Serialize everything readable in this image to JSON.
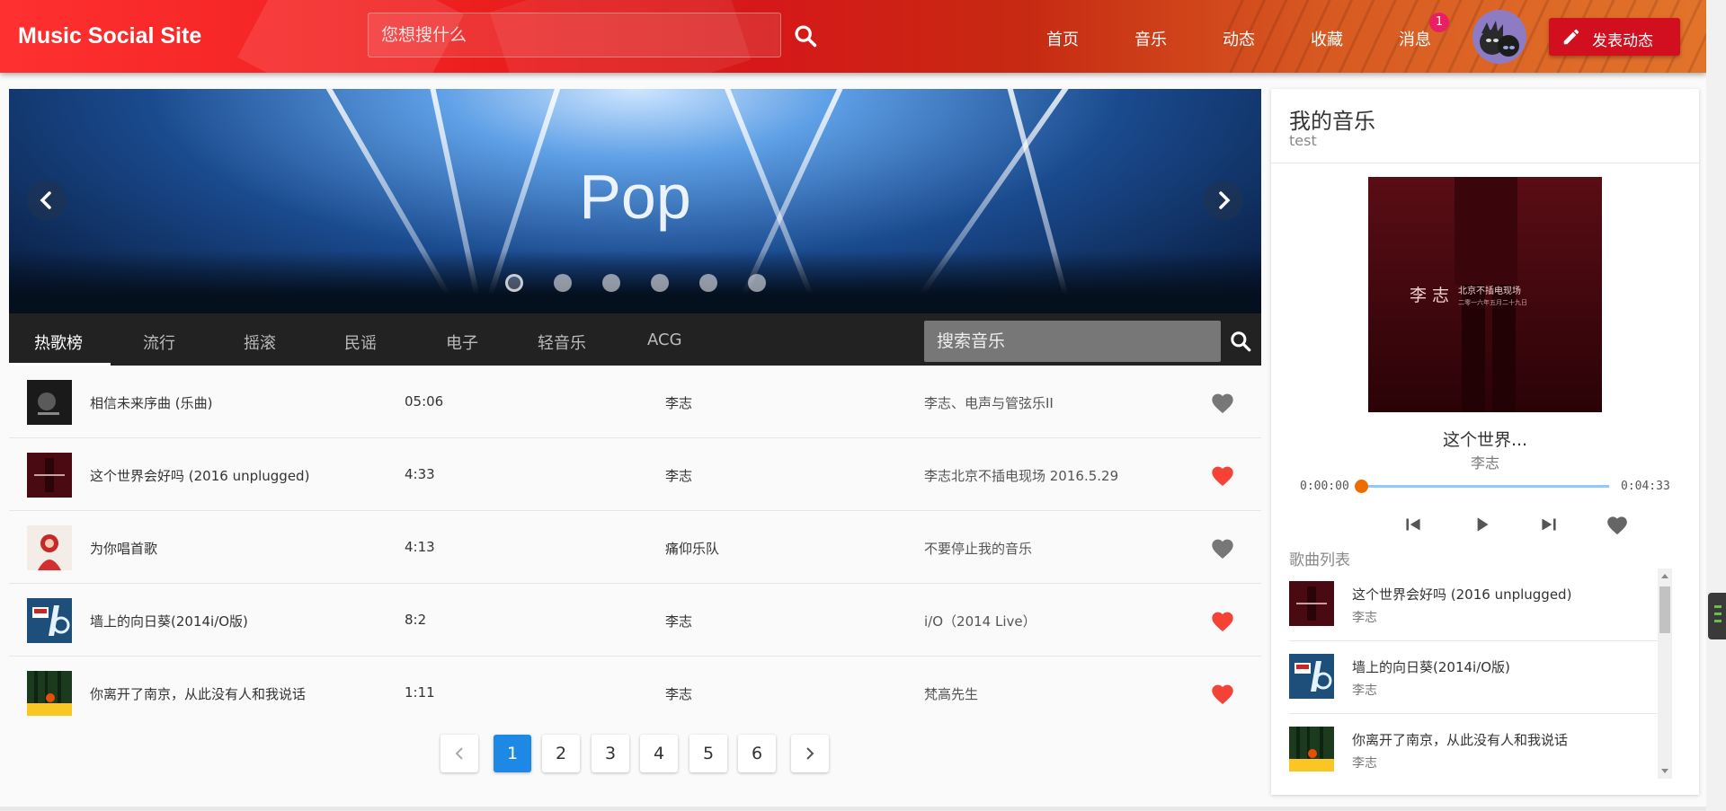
{
  "header": {
    "logo": "Music Social Site",
    "search_placeholder": "您想搜什么",
    "nav": [
      "首页",
      "音乐",
      "动态",
      "收藏",
      "消息"
    ],
    "message_badge": "1",
    "post_button": "发表动态",
    "colors": {
      "header_red": "#f02020",
      "badge": "#e91e63",
      "post_button": "#d10f1f"
    }
  },
  "banner": {
    "title": "Pop",
    "slide_count": 6,
    "active_slide": 1
  },
  "tabs": {
    "items": [
      "热歌榜",
      "流行",
      "摇滚",
      "民谣",
      "电子",
      "轻音乐",
      "ACG"
    ],
    "active": "热歌榜",
    "search_placeholder": "搜索音乐"
  },
  "songs": [
    {
      "name": "相信未来序曲 (乐曲)",
      "duration": "05:06",
      "artist": "李志",
      "album": "李志、电声与管弦乐II",
      "liked": false,
      "cover": "dark-gray"
    },
    {
      "name": "这个世界会好吗 (2016 unplugged)",
      "duration": "4:33",
      "artist": "李志",
      "album": "李志北京不插电现场 2016.5.29",
      "liked": true,
      "cover": "dark-red"
    },
    {
      "name": "为你唱首歌",
      "duration": "4:13",
      "artist": "痛仰乐队",
      "album": "不要停止我的音乐",
      "liked": false,
      "cover": "red-figure"
    },
    {
      "name": "墙上的向日葵(2014i/O版)",
      "duration": "8:2",
      "artist": "李志",
      "album": "i/O（2014 Live）",
      "liked": true,
      "cover": "blue-io"
    },
    {
      "name": "你离开了南京，从此没有人和我说话",
      "duration": "1:11",
      "artist": "李志",
      "album": "梵高先生",
      "liked": true,
      "cover": "forest-yellow"
    }
  ],
  "pagination": {
    "pages": [
      "1",
      "2",
      "3",
      "4",
      "5",
      "6"
    ],
    "current": "1"
  },
  "player": {
    "title": "我的音乐",
    "subtitle": "test",
    "now_playing": "这个世界...",
    "artist": "李志",
    "time_current": "0:00:00",
    "time_total": "0:04:33",
    "progress": 0,
    "cover_text": "李 志",
    "cover_subtext": "北京不插电现场",
    "cover_subtext2": "二零一六年五月二十九日",
    "list_label": "歌曲列表",
    "playlist": [
      {
        "name": "这个世界会好吗 (2016 unplugged)",
        "artist": "李志",
        "cover": "dark-red"
      },
      {
        "name": "墙上的向日葵(2014i/O版)",
        "artist": "李志",
        "cover": "blue-io"
      },
      {
        "name": "你离开了南京，从此没有人和我说话",
        "artist": "李志",
        "cover": "forest-yellow"
      }
    ],
    "colors": {
      "progress_track": "#90caf9",
      "progress_thumb": "#ef6c00"
    }
  },
  "icons": {
    "search": "search-icon",
    "pen": "pencil-icon",
    "heart": "heart-icon",
    "prev": "skip-previous-icon",
    "play": "play-icon",
    "next": "skip-next-icon",
    "left": "chevron-left-icon",
    "right": "chevron-right-icon"
  },
  "colors": {
    "heart_liked": "#f44336",
    "heart_unliked": "#777777",
    "page_active": "#1e88e5"
  }
}
